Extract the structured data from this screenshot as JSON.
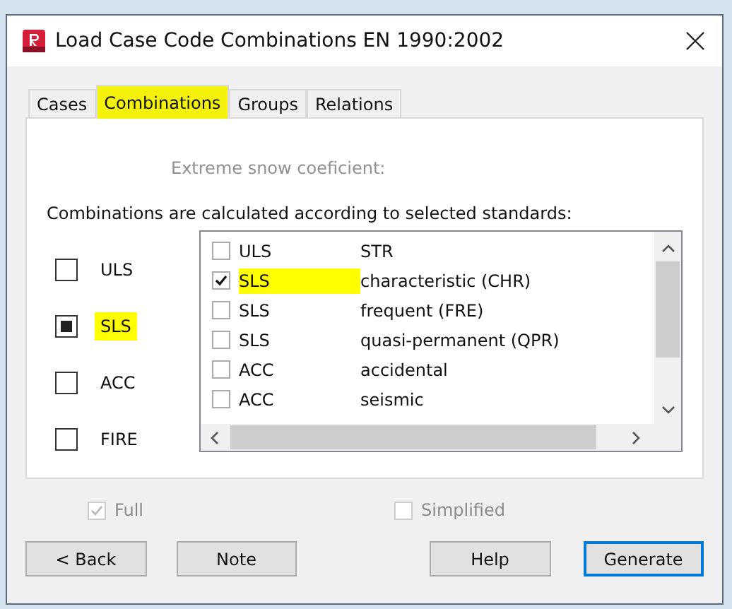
{
  "window": {
    "title": "Load Case Code Combinations EN 1990:2002"
  },
  "tabs": [
    {
      "label": "Cases",
      "selected": false,
      "highlighted": false
    },
    {
      "label": "Combinations",
      "selected": true,
      "highlighted": true
    },
    {
      "label": "Groups",
      "selected": false,
      "highlighted": false
    },
    {
      "label": "Relations",
      "selected": false,
      "highlighted": false
    }
  ],
  "snow_label": "Extreme snow coeficient:",
  "intro": "Combinations are calculated according to selected standards:",
  "limit_states": [
    {
      "label": "ULS",
      "partial": false,
      "highlighted": false
    },
    {
      "label": "SLS",
      "partial": true,
      "highlighted": true
    },
    {
      "label": "ACC",
      "partial": false,
      "highlighted": false
    },
    {
      "label": "FIRE",
      "partial": false,
      "highlighted": false
    }
  ],
  "combinations": [
    {
      "code": "ULS",
      "name": "STR",
      "checked": false,
      "highlighted": false
    },
    {
      "code": "SLS",
      "name": "characteristic (CHR)",
      "checked": true,
      "highlighted": true
    },
    {
      "code": "SLS",
      "name": "frequent (FRE)",
      "checked": false,
      "highlighted": false
    },
    {
      "code": "SLS",
      "name": "quasi-permanent (QPR)",
      "checked": false,
      "highlighted": false
    },
    {
      "code": "ACC",
      "name": "accidental",
      "checked": false,
      "highlighted": false
    },
    {
      "code": "ACC",
      "name": "seismic",
      "checked": false,
      "highlighted": false
    }
  ],
  "options": [
    {
      "label": "Full",
      "checked": true,
      "disabled": true
    },
    {
      "label": "Simplified",
      "checked": false,
      "disabled": true
    }
  ],
  "buttons": [
    {
      "label": "< Back",
      "primary": false
    },
    {
      "label": "Note",
      "primary": false
    },
    {
      "label": "Help",
      "primary": false
    },
    {
      "label": "Generate",
      "primary": true
    }
  ]
}
